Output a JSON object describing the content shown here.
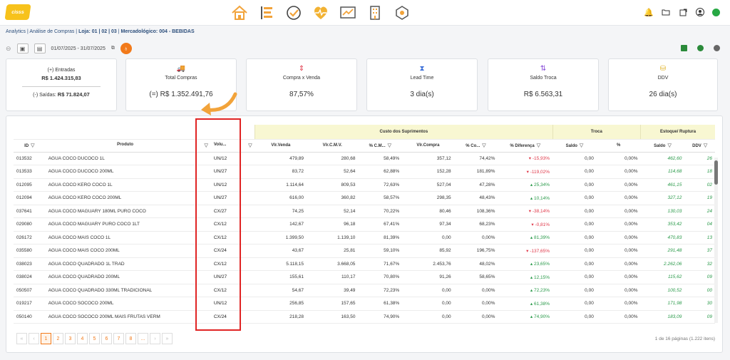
{
  "app": {
    "logo_text": "cisss",
    "breadcrumb": {
      "prefix": "Analytics | Análise de Compras | ",
      "loja_label": "Loja:",
      "loja_value": " 01 | 02 | 03",
      "sep": " | ",
      "merc_label": "Mercadológico:",
      "merc_value": " 004 - BEBIDAS"
    },
    "date_range": "01/07/2025 - 31/07/2025"
  },
  "nav_icons": [
    "home-icon",
    "list-icon",
    "check-circle-icon",
    "heart-pulse-icon",
    "chart-icon",
    "building-icon",
    "gear-network-icon"
  ],
  "colors": {
    "accent": "#f27a1a",
    "positive": "#2a9a4a",
    "negative": "#e0394a",
    "highlight": "#e02424",
    "header_yellow": "#f8f7d2"
  },
  "cards": {
    "c1": {
      "entradas_label": "(+) Entradas",
      "entradas_value": "R$ 1.424.315,83",
      "saidas_label": "(-) Saídas:",
      "saidas_value": "R$ 71.824,07"
    },
    "c2": {
      "label": "Total Compras",
      "value": "(=) R$ 1.352.491,76"
    },
    "c3": {
      "label": "Compra x Venda",
      "value": "87,57%"
    },
    "c4": {
      "label": "Lead Time",
      "value": "3 dia(s)"
    },
    "c5": {
      "label": "Saldo Troca",
      "value": "R$ 6.563,31"
    },
    "c6": {
      "label": "DDV",
      "value": "26 dia(s)"
    }
  },
  "table": {
    "groups": {
      "custo": "Custo dos Suprimentos",
      "troca": "Troca",
      "estoque": "Estoque/ Ruptura"
    },
    "columns": {
      "id": "ID",
      "produto": "Produto",
      "volume": "Volu...",
      "vl_venda": "Vlr.Venda",
      "vl_cmv": "Vlr.C.M.V.",
      "pct_cmv": "% C.M...",
      "vl_compra": "Vlr.Compra",
      "pct_co": "% Co...",
      "pct_dif": "% Diferença",
      "troca_saldo": "Saldo",
      "troca_pct": "%",
      "est_saldo": "Saldo",
      "ddv": "DDV"
    },
    "rows": [
      {
        "id": "013532",
        "produto": "AGUA COCO DUCOCO 1L",
        "vol": "UN/12",
        "venda": "479,89",
        "cmv": "280,68",
        "pcmv": "58,49%",
        "compra": "357,12",
        "pco": "74,42%",
        "dif": "▾ -15,93%",
        "difneg": true,
        "ts": "0,00",
        "tp": "0,00%",
        "es": "462,60",
        "ddv": "26"
      },
      {
        "id": "013533",
        "produto": "AGUA COCO DUCOCO 200ML",
        "vol": "UN/27",
        "venda": "83,72",
        "cmv": "52,64",
        "pcmv": "62,88%",
        "compra": "152,28",
        "pco": "181,89%",
        "dif": "▾ -119,02%",
        "difneg": true,
        "ts": "0,00",
        "tp": "0,00%",
        "es": "114,68",
        "ddv": "18"
      },
      {
        "id": "012095",
        "produto": "AGUA COCO KERO COCO 1L",
        "vol": "UN/12",
        "venda": "1.114,64",
        "cmv": "809,53",
        "pcmv": "72,63%",
        "compra": "527,04",
        "pco": "47,28%",
        "dif": "▴ 25,34%",
        "difneg": false,
        "ts": "0,00",
        "tp": "0,00%",
        "es": "461,15",
        "ddv": "02"
      },
      {
        "id": "012094",
        "produto": "AGUA COCO KERO COCO 200ML",
        "vol": "UN/27",
        "venda": "616,00",
        "cmv": "360,82",
        "pcmv": "58,57%",
        "compra": "298,35",
        "pco": "48,43%",
        "dif": "▴ 10,14%",
        "difneg": false,
        "ts": "0,00",
        "tp": "0,00%",
        "es": "327,12",
        "ddv": "19"
      },
      {
        "id": "037641",
        "produto": "AGUA COCO MAGUARY 180ML PURO COCO",
        "vol": "CX/27",
        "venda": "74,25",
        "cmv": "52,14",
        "pcmv": "70,22%",
        "compra": "80,46",
        "pco": "108,36%",
        "dif": "▾ -38,14%",
        "difneg": true,
        "ts": "0,00",
        "tp": "0,00%",
        "es": "130,03",
        "ddv": "24"
      },
      {
        "id": "029080",
        "produto": "AGUA COCO MAGUARY PURO COCO 1LT",
        "vol": "CX/12",
        "venda": "142,67",
        "cmv": "96,18",
        "pcmv": "67,41%",
        "compra": "97,34",
        "pco": "68,23%",
        "dif": "▾ -0,81%",
        "difneg": true,
        "ts": "0,00",
        "tp": "0,00%",
        "es": "353,42",
        "ddv": "04"
      },
      {
        "id": "026172",
        "produto": "AGUA COCO MAIS COCO 1L",
        "vol": "CX/12",
        "venda": "1.399,50",
        "cmv": "1.139,10",
        "pcmv": "81,39%",
        "compra": "0,00",
        "pco": "0,00%",
        "dif": "▴ 81,39%",
        "difneg": false,
        "ts": "0,00",
        "tp": "0,00%",
        "es": "470,83",
        "ddv": "13"
      },
      {
        "id": "035580",
        "produto": "AGUA COCO MAIS COCO 200ML",
        "vol": "CX/24",
        "venda": "43,67",
        "cmv": "25,81",
        "pcmv": "59,10%",
        "compra": "85,92",
        "pco": "196,75%",
        "dif": "▾ -137,65%",
        "difneg": true,
        "ts": "0,00",
        "tp": "0,00%",
        "es": "291,48",
        "ddv": "37"
      },
      {
        "id": "038023",
        "produto": "AGUA COCO QUADRADO 1L TRAD",
        "vol": "CX/12",
        "venda": "5.118,15",
        "cmv": "3.668,05",
        "pcmv": "71,67%",
        "compra": "2.453,76",
        "pco": "48,02%",
        "dif": "▴ 23,65%",
        "difneg": false,
        "ts": "0,00",
        "tp": "0,00%",
        "es": "2.262,06",
        "ddv": "32"
      },
      {
        "id": "038024",
        "produto": "AGUA COCO QUADRADO 200ML",
        "vol": "UN/27",
        "venda": "155,61",
        "cmv": "110,17",
        "pcmv": "70,80%",
        "compra": "91,26",
        "pco": "58,65%",
        "dif": "▴ 12,15%",
        "difneg": false,
        "ts": "0,00",
        "tp": "0,00%",
        "es": "115,62",
        "ddv": "09"
      },
      {
        "id": "050507",
        "produto": "AGUA COCO QUADRADO 330ML TRADICIONAL",
        "vol": "CX/12",
        "venda": "54,67",
        "cmv": "39,49",
        "pcmv": "72,23%",
        "compra": "0,00",
        "pco": "0,00%",
        "dif": "▴ 72,23%",
        "difneg": false,
        "ts": "0,00",
        "tp": "0,00%",
        "es": "100,52",
        "ddv": "00"
      },
      {
        "id": "019217",
        "produto": "AGUA COCO SOCOCO 200ML",
        "vol": "UN/12",
        "venda": "256,85",
        "cmv": "157,65",
        "pcmv": "61,38%",
        "compra": "0,00",
        "pco": "0,00%",
        "dif": "▴ 61,38%",
        "difneg": false,
        "ts": "0,00",
        "tp": "0,00%",
        "es": "171,98",
        "ddv": "30"
      },
      {
        "id": "050140",
        "produto": "AGUA COCO SOCOCO 200ML MAIS FRUTAS VERM",
        "vol": "CX/24",
        "venda": "218,28",
        "cmv": "163,50",
        "pcmv": "74,90%",
        "compra": "0,00",
        "pco": "0,00%",
        "dif": "▴ 74,90%",
        "difneg": false,
        "ts": "0,00",
        "tp": "0,00%",
        "es": "183,09",
        "ddv": "09"
      }
    ]
  },
  "pagination": {
    "pages": [
      "«",
      "‹",
      "1",
      "2",
      "3",
      "4",
      "5",
      "6",
      "7",
      "8",
      "...",
      "›",
      "»"
    ],
    "active": "1",
    "info": "1 de 16 páginas (1.222 itens)"
  }
}
